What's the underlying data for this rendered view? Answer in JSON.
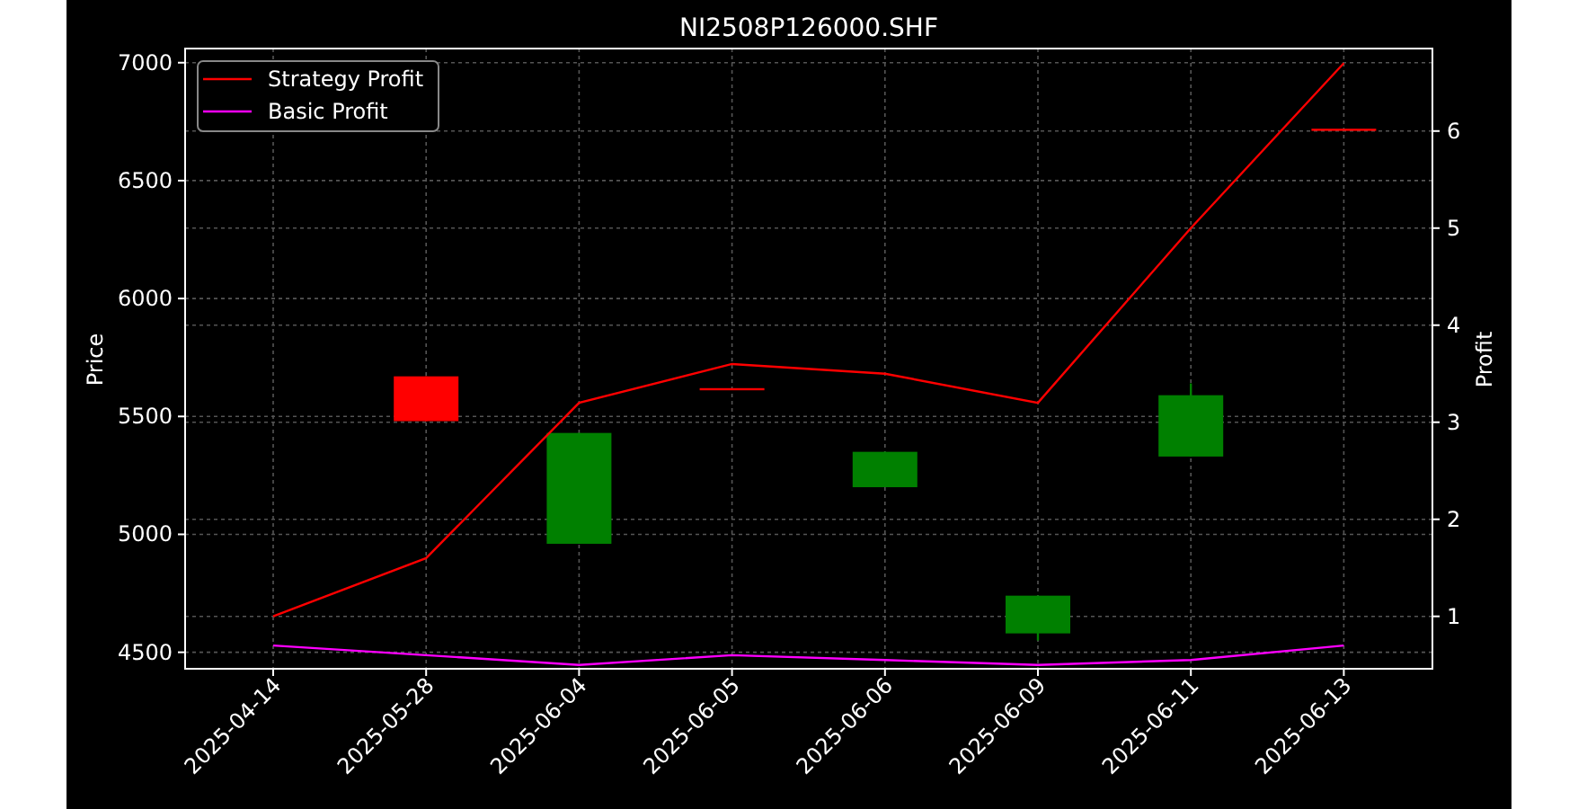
{
  "chart_data": {
    "type": "line",
    "title": "NI2508P126000.SHF",
    "ylabel": "Price",
    "y2label": "Profit",
    "categories": [
      "2025-04-14",
      "2025-05-28",
      "2025-06-04",
      "2025-06-05",
      "2025-06-06",
      "2025-06-09",
      "2025-06-11",
      "2025-06-13"
    ],
    "series": [
      {
        "name": "Strategy Profit",
        "color": "#ff0000",
        "axis": "y2",
        "values": [
          1.0,
          1.6,
          3.2,
          3.6,
          3.5,
          3.2,
          5.0,
          6.7
        ]
      },
      {
        "name": "Basic Profit",
        "color": "#ff00ff",
        "axis": "y2",
        "values": [
          0.7,
          0.6,
          0.5,
          0.6,
          0.55,
          0.5,
          0.55,
          0.7
        ]
      },
      {
        "type": "candlestick",
        "ohlc": [
          null,
          [
            5670,
            5670,
            5480,
            5480
          ],
          [
            4960,
            5430,
            4960,
            5430
          ],
          [
            5620,
            5620,
            5620,
            5620
          ],
          [
            5200,
            5350,
            5200,
            5350
          ],
          [
            4580,
            4740,
            4550,
            4740
          ],
          [
            5330,
            5640,
            5330,
            5590
          ],
          [
            6720,
            6720,
            6720,
            6720
          ]
        ]
      }
    ],
    "ylim": [
      4430,
      7060
    ],
    "yticks": [
      4500,
      5000,
      5500,
      6000,
      6500,
      7000
    ],
    "y2lim": [
      0.46,
      6.85
    ],
    "y2ticks": [
      1,
      2,
      3,
      4,
      5,
      6
    ],
    "grid": true,
    "legend": "upper left"
  }
}
